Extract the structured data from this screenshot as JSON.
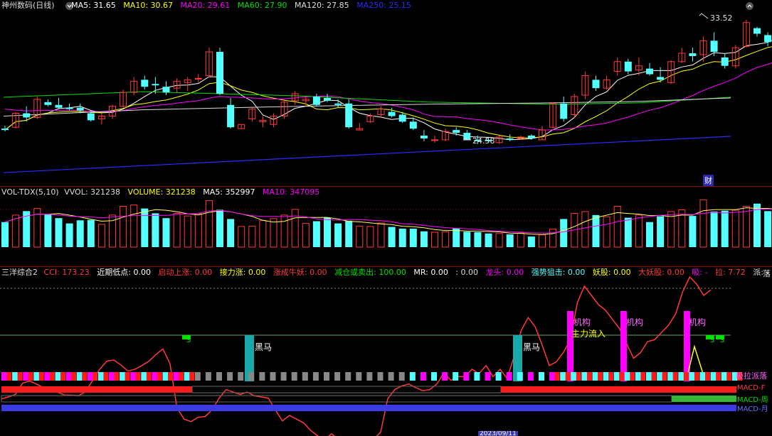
{
  "main_header": {
    "title": "神州数码(日线)",
    "ma5": "MA5: 31.65",
    "ma10": "MA10: 30.67",
    "ma20": "MA20: 29.61",
    "ma60": "MA60: 27.90",
    "ma120": "MA120: 27.85",
    "ma250": "MA250: 25.15"
  },
  "main_annotations": {
    "high": "33.52",
    "low": "24.58",
    "cai": "财"
  },
  "vol_header": {
    "title": "VOL-TDX(5,10)",
    "vvol": "VVOL: 321238",
    "volume": "VOLUME: 321238",
    "ma5": "MA5: 352997",
    "ma10": "MA10: 347095"
  },
  "ind_header": {
    "title": "三洋综合2",
    "cci": "CCI: 173.23",
    "near_low": "近期低点: 0.00",
    "start_up": "启动上涨: 0.00",
    "relay_up": "接力涨: 0.00",
    "bull": "涨成牛妖: 0.00",
    "reduce": "减仓或卖出: 100.00",
    "mr": "MR: 0.00",
    "blank": ": 0.00",
    "dragon": "龙头: 0.00",
    "snipe": "强势狙击: 0.00",
    "demon": "妖股: 0.00",
    "big_demon": "大妖股: 0.00",
    "suck": "吸: -",
    "pull": "拉: 7.72",
    "send": "派: -",
    "fall": "落"
  },
  "ind_labels": {
    "black_horse_1": "黑马",
    "black_horse_2": "黑马",
    "jigou_1": "机构",
    "jigou_2": "机构",
    "jigou_3": "机构",
    "main_inflow": "主力流入",
    "s_mark": "S",
    "xilapailuo": "吸拉派落",
    "macd_1": "MACD-F",
    "macd_2": "MACD-周",
    "macd_3": "MACD-月",
    "date_stub": "2023/09/11"
  },
  "icons": {
    "menu": "chevron-down-icon",
    "window": "chevron-up-icon"
  },
  "colors": {
    "up": "#ff3a3a",
    "down": "#54ffff",
    "ma5": "#ffffff",
    "ma10": "#ffff00",
    "ma20": "#ff00ff",
    "ma60": "#00e000",
    "ma120": "#dddddd",
    "ma250": "#2b2bff"
  },
  "chart_data": {
    "type": "candlestick",
    "y_range": [
      22.3,
      34.0
    ],
    "candles": [
      [
        25.7,
        25.9,
        25.5,
        25.6
      ],
      [
        25.8,
        26.9,
        25.7,
        26.8
      ],
      [
        26.8,
        27.3,
        26.2,
        26.5
      ],
      [
        26.5,
        28.0,
        26.4,
        27.8
      ],
      [
        27.6,
        27.8,
        27.3,
        27.4
      ],
      [
        27.4,
        27.9,
        27.1,
        27.2
      ],
      [
        27.2,
        27.5,
        27.0,
        27.1
      ],
      [
        27.2,
        27.5,
        26.8,
        27.0
      ],
      [
        26.8,
        27.0,
        26.2,
        26.3
      ],
      [
        26.4,
        26.8,
        26.0,
        26.6
      ],
      [
        26.6,
        27.4,
        26.4,
        27.3
      ],
      [
        27.3,
        28.5,
        27.2,
        28.3
      ],
      [
        28.3,
        29.4,
        28.1,
        29.1
      ],
      [
        29.2,
        29.5,
        28.5,
        28.7
      ],
      [
        28.9,
        29.4,
        28.2,
        28.8
      ],
      [
        28.7,
        29.1,
        28.1,
        28.3
      ],
      [
        28.6,
        29.3,
        28.3,
        29.1
      ],
      [
        29.0,
        29.4,
        28.4,
        29.2
      ],
      [
        29.3,
        29.6,
        29.0,
        29.3
      ],
      [
        29.5,
        31.5,
        29.4,
        31.2
      ],
      [
        31.2,
        31.5,
        28.1,
        28.2
      ],
      [
        27.4,
        27.9,
        25.7,
        25.8
      ],
      [
        25.7,
        26.0,
        25.7,
        26.0
      ],
      [
        26.4,
        27.2,
        26.2,
        27.1
      ],
      [
        26.2,
        26.6,
        25.8,
        26.3
      ],
      [
        26.0,
        26.8,
        25.8,
        26.6
      ],
      [
        26.6,
        27.8,
        26.4,
        27.6
      ],
      [
        27.7,
        28.4,
        27.4,
        28.2
      ],
      [
        27.7,
        28.0,
        27.3,
        27.8
      ],
      [
        28.0,
        28.2,
        27.3,
        27.4
      ],
      [
        27.9,
        28.2,
        27.6,
        27.7
      ],
      [
        27.5,
        27.8,
        27.2,
        27.4
      ],
      [
        27.5,
        27.8,
        25.7,
        25.8
      ],
      [
        25.6,
        26.1,
        25.6,
        25.7
      ],
      [
        26.2,
        26.8,
        26.1,
        26.6
      ],
      [
        26.7,
        27.3,
        26.5,
        27.1
      ],
      [
        26.9,
        27.2,
        26.5,
        26.6
      ],
      [
        26.7,
        26.9,
        26.1,
        26.2
      ],
      [
        26.2,
        26.5,
        25.6,
        25.7
      ],
      [
        25.2,
        25.6,
        24.8,
        25.0
      ],
      [
        24.9,
        25.2,
        24.7,
        24.9
      ],
      [
        24.9,
        25.7,
        24.8,
        25.5
      ],
      [
        25.6,
        25.8,
        25.2,
        25.4
      ],
      [
        25.4,
        25.6,
        24.9,
        24.9
      ],
      [
        24.9,
        25.2,
        24.6,
        24.8
      ],
      [
        24.9,
        25.0,
        24.7,
        24.8
      ],
      [
        24.7,
        25.2,
        24.6,
        25.1
      ],
      [
        25.0,
        25.3,
        24.8,
        24.9
      ],
      [
        25.0,
        25.2,
        24.9,
        25.1
      ],
      [
        25.2,
        25.3,
        24.9,
        25.0
      ],
      [
        24.9,
        25.9,
        24.9,
        25.6
      ],
      [
        25.8,
        27.6,
        25.7,
        27.5
      ],
      [
        27.5,
        28.0,
        26.2,
        26.4
      ],
      [
        26.7,
        28.2,
        26.5,
        28.0
      ],
      [
        28.1,
        29.8,
        27.8,
        29.5
      ],
      [
        29.2,
        29.5,
        28.4,
        28.6
      ],
      [
        28.6,
        29.5,
        28.5,
        29.2
      ],
      [
        29.8,
        30.8,
        29.5,
        30.5
      ],
      [
        30.5,
        30.7,
        29.6,
        29.8
      ],
      [
        29.9,
        30.8,
        29.5,
        30.2
      ],
      [
        30.0,
        30.4,
        29.5,
        29.6
      ],
      [
        29.4,
        30.1,
        29.0,
        29.2
      ],
      [
        29.0,
        30.6,
        28.9,
        30.5
      ],
      [
        30.5,
        31.5,
        30.4,
        31.1
      ],
      [
        31.1,
        31.5,
        30.5,
        30.9
      ],
      [
        31.0,
        32.3,
        30.5,
        32.0
      ],
      [
        32.0,
        32.6,
        30.9,
        31.2
      ],
      [
        30.8,
        31.1,
        30.0,
        30.2
      ],
      [
        30.2,
        31.7,
        30.0,
        31.5
      ],
      [
        31.6,
        33.5,
        31.5,
        33.3
      ],
      [
        32.9,
        33.0,
        32.3,
        32.5
      ],
      [
        32.4,
        32.6,
        31.6,
        31.9
      ],
      [
        31.5,
        32.1,
        31.2,
        32.0
      ],
      [
        31.9,
        32.8,
        31.4,
        32.6
      ]
    ],
    "volumes": [
      0.57,
      0.73,
      0.82,
      0.88,
      0.74,
      0.66,
      0.54,
      0.61,
      0.62,
      0.52,
      0.73,
      0.93,
      0.96,
      0.88,
      0.77,
      0.66,
      0.77,
      0.71,
      0.76,
      1.06,
      0.85,
      0.64,
      0.47,
      0.48,
      0.61,
      0.65,
      0.73,
      0.86,
      0.54,
      0.59,
      0.67,
      0.54,
      0.6,
      0.48,
      0.47,
      0.55,
      0.46,
      0.42,
      0.42,
      0.36,
      0.34,
      0.35,
      0.43,
      0.35,
      0.34,
      0.31,
      0.31,
      0.29,
      0.32,
      0.24,
      0.28,
      0.41,
      0.64,
      0.77,
      0.81,
      0.73,
      0.69,
      0.93,
      0.67,
      0.73,
      0.57,
      0.7,
      0.81,
      0.85,
      0.71,
      1.08,
      0.81,
      0.83,
      0.84,
      0.93,
      0.99,
      0.82,
      0.69,
      0.95
    ],
    "cci": [
      -30,
      -25,
      -18,
      12,
      18,
      10,
      0,
      -6,
      -12,
      -20,
      -20,
      -22,
      -10,
      20,
      50,
      72,
      75,
      62,
      45,
      50,
      60,
      72,
      90,
      105,
      65,
      -55,
      -85,
      -92,
      -80,
      -78,
      -60,
      -28,
      -5,
      -12,
      -18,
      -12,
      -22,
      -25,
      -28,
      -60,
      -90,
      -75,
      -85,
      -95,
      -115,
      -130,
      -140,
      -125,
      -140,
      -155,
      -148,
      -140,
      -150,
      -140,
      -120,
      -30,
      -5,
      5,
      10,
      0,
      -8,
      -5,
      10,
      40,
      20,
      30,
      30,
      50,
      38,
      60,
      30,
      50,
      25,
      85,
      155,
      190,
      165,
      115,
      60,
      70,
      95,
      130,
      230,
      275,
      250,
      225,
      210,
      185,
      160,
      120,
      80,
      95,
      125,
      130,
      150,
      170,
      200,
      260,
      300,
      280,
      250,
      265
    ]
  }
}
